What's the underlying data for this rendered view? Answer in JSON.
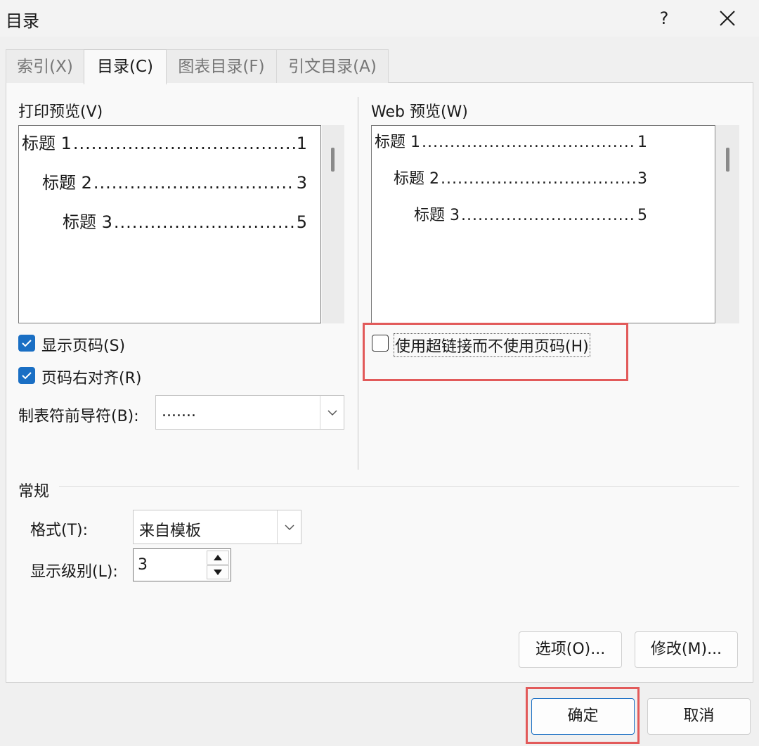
{
  "window": {
    "title": "目录",
    "help_label": "?"
  },
  "tabs": [
    {
      "label": "索引(X)",
      "active": false
    },
    {
      "label": "目录(C)",
      "active": true
    },
    {
      "label": "图表目录(F)",
      "active": false
    },
    {
      "label": "引文目录(A)",
      "active": false
    }
  ],
  "print_preview": {
    "label": "打印预览(V)",
    "entries": [
      {
        "text": "标题  1",
        "page": "1"
      },
      {
        "text": "标题  2",
        "page": "3"
      },
      {
        "text": "标题  3",
        "page": "5"
      }
    ]
  },
  "web_preview": {
    "label": "Web 预览(W)",
    "entries": [
      {
        "text": "标题  1",
        "page": "1"
      },
      {
        "text": "标题  2",
        "page": "3"
      },
      {
        "text": "标题  3",
        "page": "5"
      }
    ]
  },
  "options": {
    "show_page_numbers": {
      "label": "显示页码(S)",
      "checked": true
    },
    "right_align": {
      "label": "页码右对齐(R)",
      "checked": true
    },
    "tab_leader": {
      "label": "制表符前导符(B):",
      "value": "......."
    },
    "use_hyperlinks": {
      "label": "使用超链接而不使用页码(H)",
      "checked": false
    }
  },
  "general": {
    "section_label": "常规",
    "format": {
      "label": "格式(T):",
      "value": "来自模板"
    },
    "levels": {
      "label": "显示级别(L):",
      "value": "3"
    }
  },
  "buttons": {
    "options": "选项(O)...",
    "modify": "修改(M)...",
    "ok": "确定",
    "cancel": "取消"
  },
  "colors": {
    "accent": "#1a6fc4",
    "highlight_box": "#e25a5a"
  }
}
